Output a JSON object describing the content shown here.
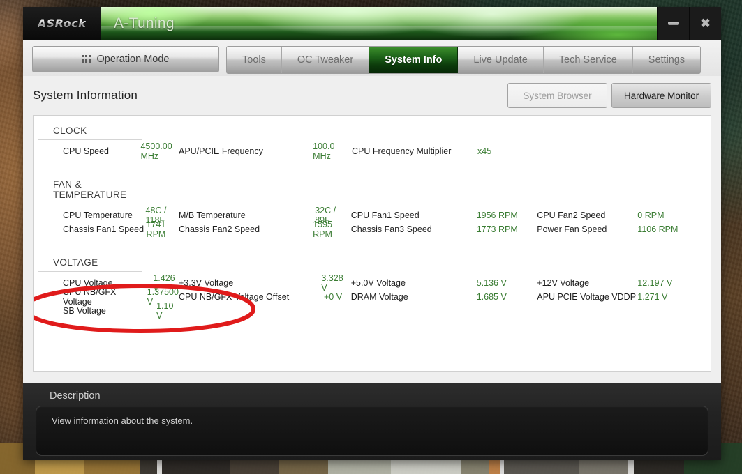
{
  "window": {
    "brand": "ASRock",
    "title": "A-Tuning",
    "minimize_label": "",
    "close_label": "✖"
  },
  "tabs": {
    "operation_mode": {
      "label": "Operation Mode",
      "icon": "grid-icon"
    },
    "items": [
      {
        "label": "Tools",
        "active": false
      },
      {
        "label": "OC Tweaker",
        "active": false
      },
      {
        "label": "System Info",
        "active": true
      },
      {
        "label": "Live Update",
        "active": false
      },
      {
        "label": "Tech Service",
        "active": false
      },
      {
        "label": "Settings",
        "active": false
      }
    ]
  },
  "page": {
    "title": "System Information",
    "buttons": [
      {
        "label": "System Browser",
        "state": "inactive"
      },
      {
        "label": "Hardware Monitor",
        "state": "active"
      }
    ]
  },
  "sections": [
    {
      "title": "CLOCK",
      "rows": [
        [
          {
            "label": "CPU Speed",
            "value": "4500.00 MHz"
          },
          {
            "label": "APU/PCIE Frequency",
            "value": "100.0 MHz"
          },
          {
            "label": "CPU Frequency Multiplier",
            "value": "x45"
          }
        ]
      ]
    },
    {
      "title": "FAN & TEMPERATURE",
      "rows": [
        [
          {
            "label": "CPU Temperature",
            "value": "48C / 118F"
          },
          {
            "label": "M/B Temperature",
            "value": "32C / 89F"
          },
          {
            "label": "CPU Fan1 Speed",
            "value": "1956 RPM"
          },
          {
            "label": "CPU Fan2 Speed",
            "value": "0 RPM"
          }
        ],
        [
          {
            "label": "Chassis Fan1 Speed",
            "value": "1741 RPM"
          },
          {
            "label": "Chassis Fan2 Speed",
            "value": "1595 RPM"
          },
          {
            "label": "Chassis Fan3 Speed",
            "value": "1773 RPM"
          },
          {
            "label": "Power Fan Speed",
            "value": "1106 RPM"
          }
        ]
      ]
    },
    {
      "title": "VOLTAGE",
      "rows": [
        [
          {
            "label": "CPU Voltage",
            "value": "1.426 V"
          },
          {
            "label": "+3.3V Voltage",
            "value": "3.328 V"
          },
          {
            "label": "+5.0V Voltage",
            "value": "5.136 V"
          },
          {
            "label": "+12V Voltage",
            "value": "12.197 V"
          }
        ],
        [
          {
            "label": "CPU NB/GFX Voltage",
            "value": "1.37500 V"
          },
          {
            "label": "CPU NB/GFX Voltage Offset",
            "value": "+0 V"
          },
          {
            "label": "DRAM Voltage",
            "value": "1.685 V"
          },
          {
            "label": "APU PCIE Voltage VDDP",
            "value": "1.271 V"
          }
        ],
        [
          {
            "label": "SB Voltage",
            "value": "1.10 V"
          }
        ]
      ]
    }
  ],
  "description": {
    "title": "Description",
    "text": "View information about the system."
  },
  "annotation": {
    "shape": "ellipse",
    "color": "#e01b1b",
    "encircles": "CPU Temperature 48C / 118F and Chassis Fan1 Speed 1741 RPM"
  },
  "colors": {
    "value_green": "#3b7d34",
    "active_tab_green": "#1d6218",
    "annotation_red": "#e01b1b"
  }
}
